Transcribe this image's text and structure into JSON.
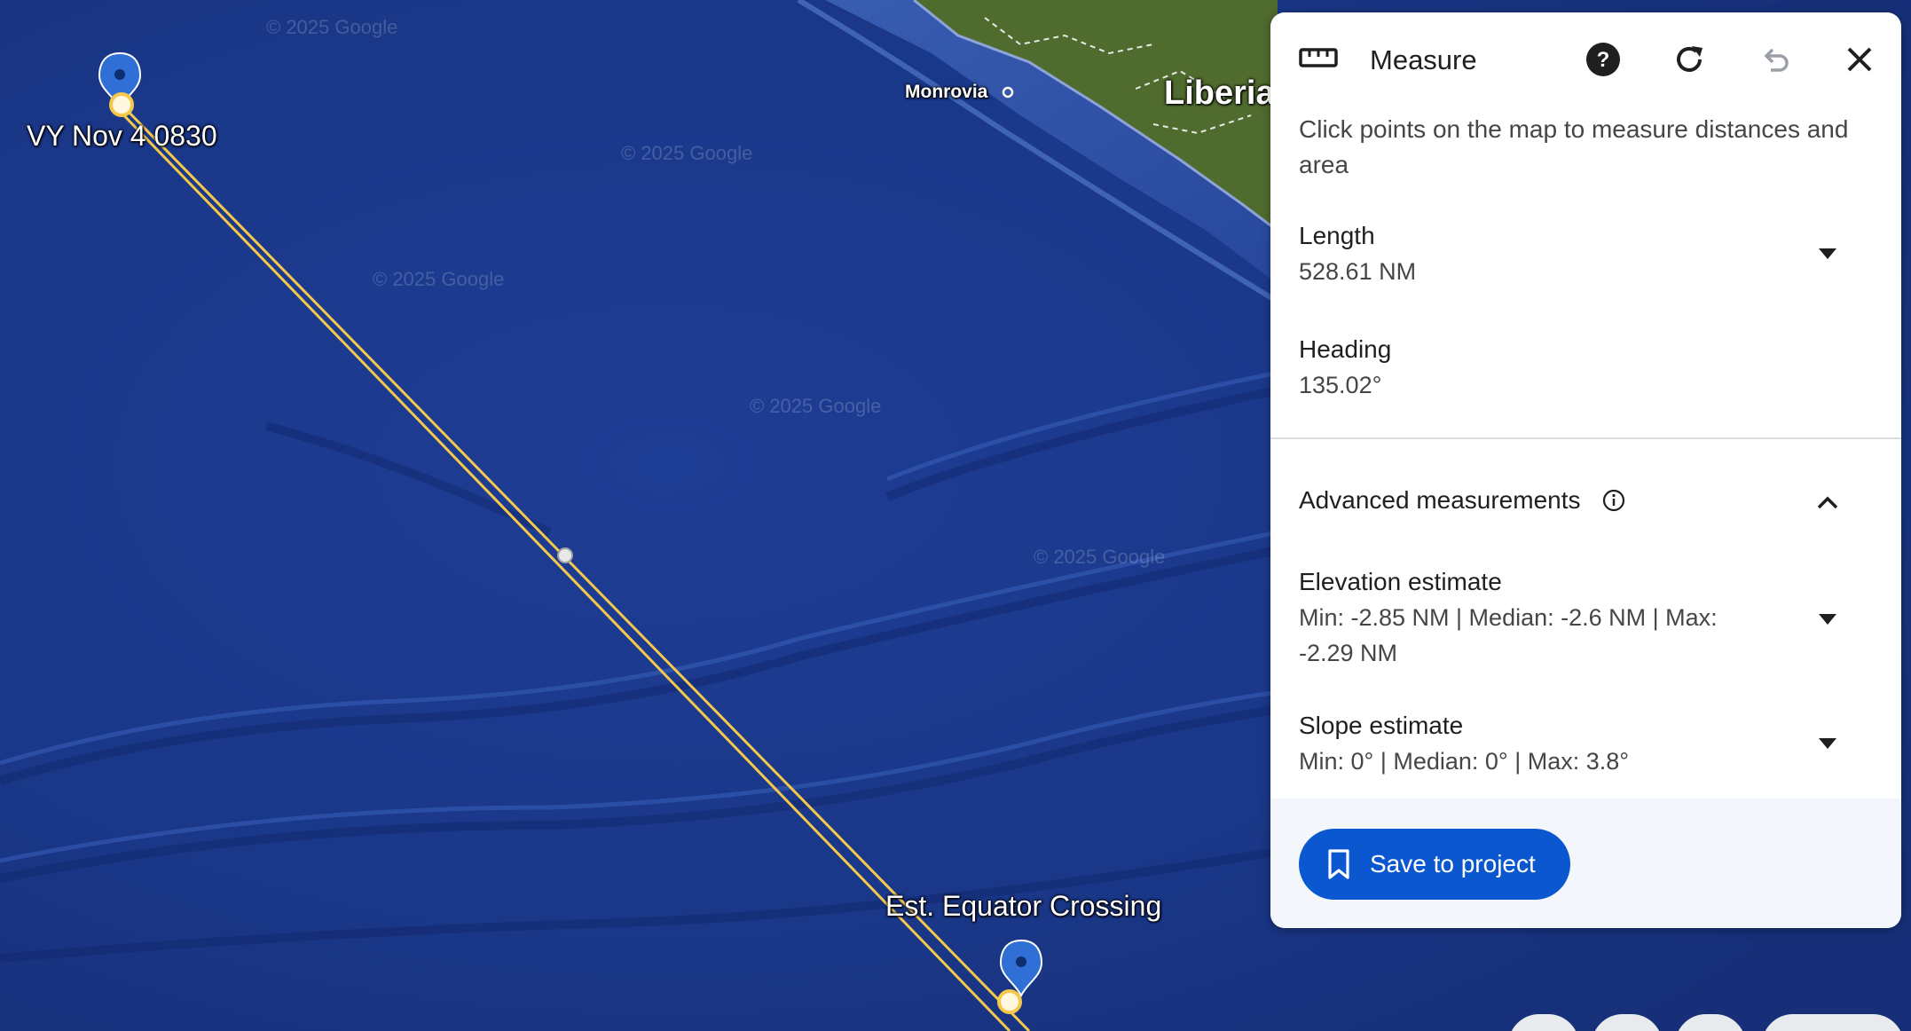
{
  "map": {
    "labels": {
      "start_point": "VY Nov 4 0830",
      "end_point": "Est. Equator Crossing",
      "city": "Monrovia",
      "country": "Liberia"
    },
    "watermark": "© 2025 Google",
    "colors": {
      "ocean": "#1a3a8a",
      "land": "#4f6b2e",
      "measure_line": "#f4c84a",
      "pin": "#2f6fd6"
    }
  },
  "panel": {
    "title": "Measure",
    "icons": {
      "title": "ruler-icon",
      "help": "help-icon",
      "reset": "refresh-icon",
      "undo": "undo-icon",
      "close": "close-icon"
    },
    "description": "Click points on the map to measure distances and area",
    "length": {
      "label": "Length",
      "value": "528.61 NM"
    },
    "heading": {
      "label": "Heading",
      "value": "135.02°"
    },
    "advanced": {
      "label": "Advanced measurements",
      "elevation": {
        "label": "Elevation estimate",
        "value_line1": "Min: -2.85 NM | Median: -2.6 NM | Max:",
        "value_line2": "-2.29 NM"
      },
      "slope": {
        "label": "Slope estimate",
        "value": "Min: 0° | Median: 0° | Max: 3.8°"
      }
    },
    "save_button": "Save to project",
    "colors": {
      "accent": "#0b57d0"
    }
  }
}
